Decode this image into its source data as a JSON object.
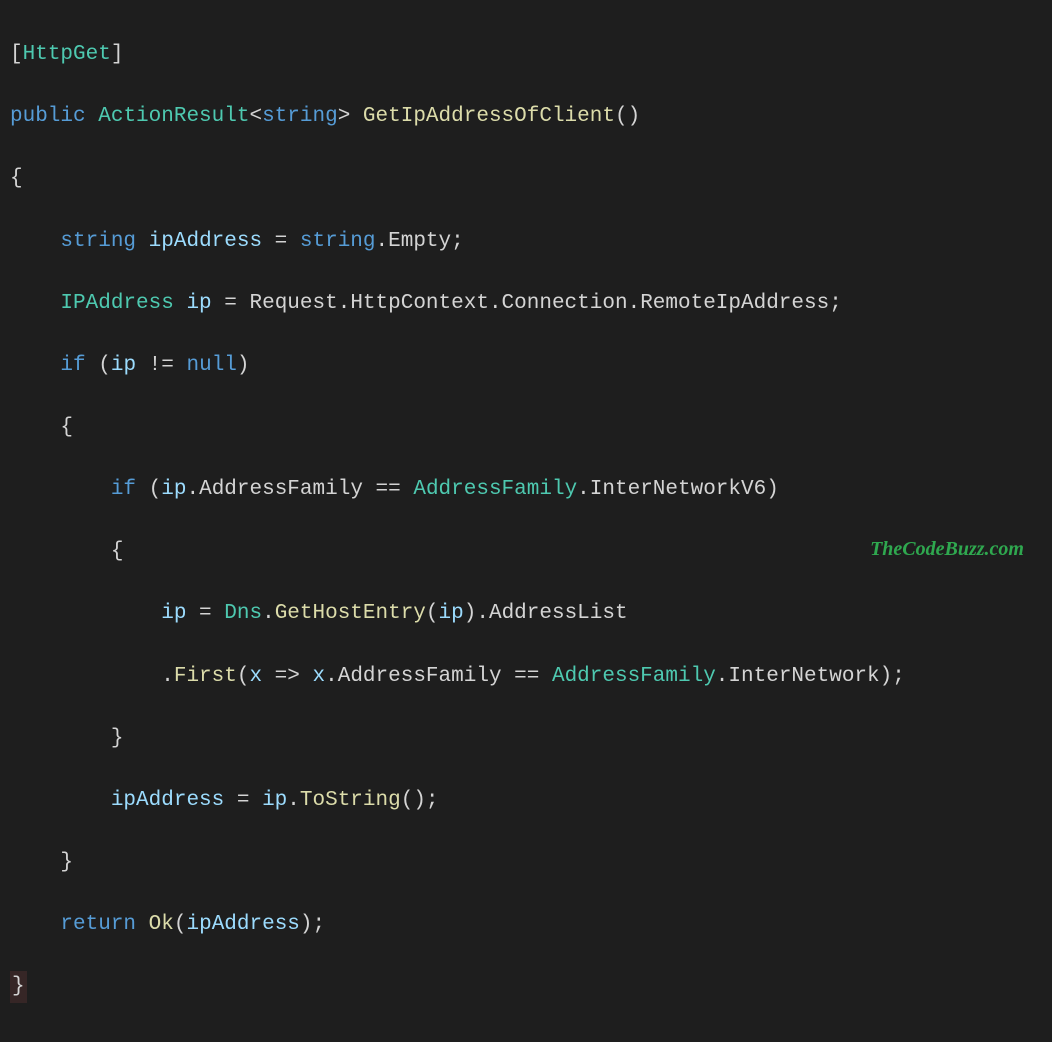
{
  "code": {
    "l1_open": "[",
    "l1_attr": "HttpGet",
    "l1_close": "]",
    "l2_kw1": "public",
    "l2_type1": "ActionResult",
    "l2_lt": "<",
    "l2_type2": "string",
    "l2_gt": ">",
    "l2_method": "GetIpAddressOfClient",
    "l2_parens": "()",
    "l3": "{",
    "l4_kw": "string",
    "l4_var": "ipAddress",
    "l4_eq": " = ",
    "l4_type": "string",
    "l4_dot": ".",
    "l4_prop": "Empty",
    "l4_semi": ";",
    "l5_type": "IPAddress",
    "l5_var": "ip",
    "l5_eq": " = ",
    "l5_req": "Request",
    "l5_d1": ".",
    "l5_p1": "HttpContext",
    "l5_d2": ".",
    "l5_p2": "Connection",
    "l5_d3": ".",
    "l5_p3": "RemoteIpAddress",
    "l5_semi": ";",
    "l6_kw": "if",
    "l6_open": " (",
    "l6_var": "ip",
    "l6_op": " != ",
    "l6_null": "null",
    "l6_close": ")",
    "l7": "{",
    "l8_kw": "if",
    "l8_open": " (",
    "l8_var": "ip",
    "l8_dot": ".",
    "l8_prop": "AddressFamily",
    "l8_eq": " == ",
    "l8_type": "AddressFamily",
    "l8_dot2": ".",
    "l8_val": "InterNetworkV6",
    "l8_close": ")",
    "l9": "{",
    "l10_var": "ip",
    "l10_eq": " = ",
    "l10_type": "Dns",
    "l10_dot": ".",
    "l10_m1": "GetHostEntry",
    "l10_open": "(",
    "l10_arg": "ip",
    "l10_close": ").",
    "l10_prop": "AddressList",
    "l11_dot": ".",
    "l11_m": "First",
    "l11_open": "(",
    "l11_x": "x",
    "l11_arrow": " => ",
    "l11_x2": "x",
    "l11_d2": ".",
    "l11_prop": "AddressFamily",
    "l11_eq": " == ",
    "l11_type": "AddressFamily",
    "l11_d3": ".",
    "l11_val": "InterNetwork",
    "l11_close": ");",
    "l12": "}",
    "l13_var": "ipAddress",
    "l13_eq": " = ",
    "l13_ip": "ip",
    "l13_dot": ".",
    "l13_m": "ToString",
    "l13_parens": "();",
    "l14": "}",
    "l15_kw": "return",
    "l15_sp": " ",
    "l15_m": "Ok",
    "l15_open": "(",
    "l15_arg": "ipAddress",
    "l15_close": ");",
    "l16": "}"
  },
  "watermark": "TheCodeBuzz.com"
}
